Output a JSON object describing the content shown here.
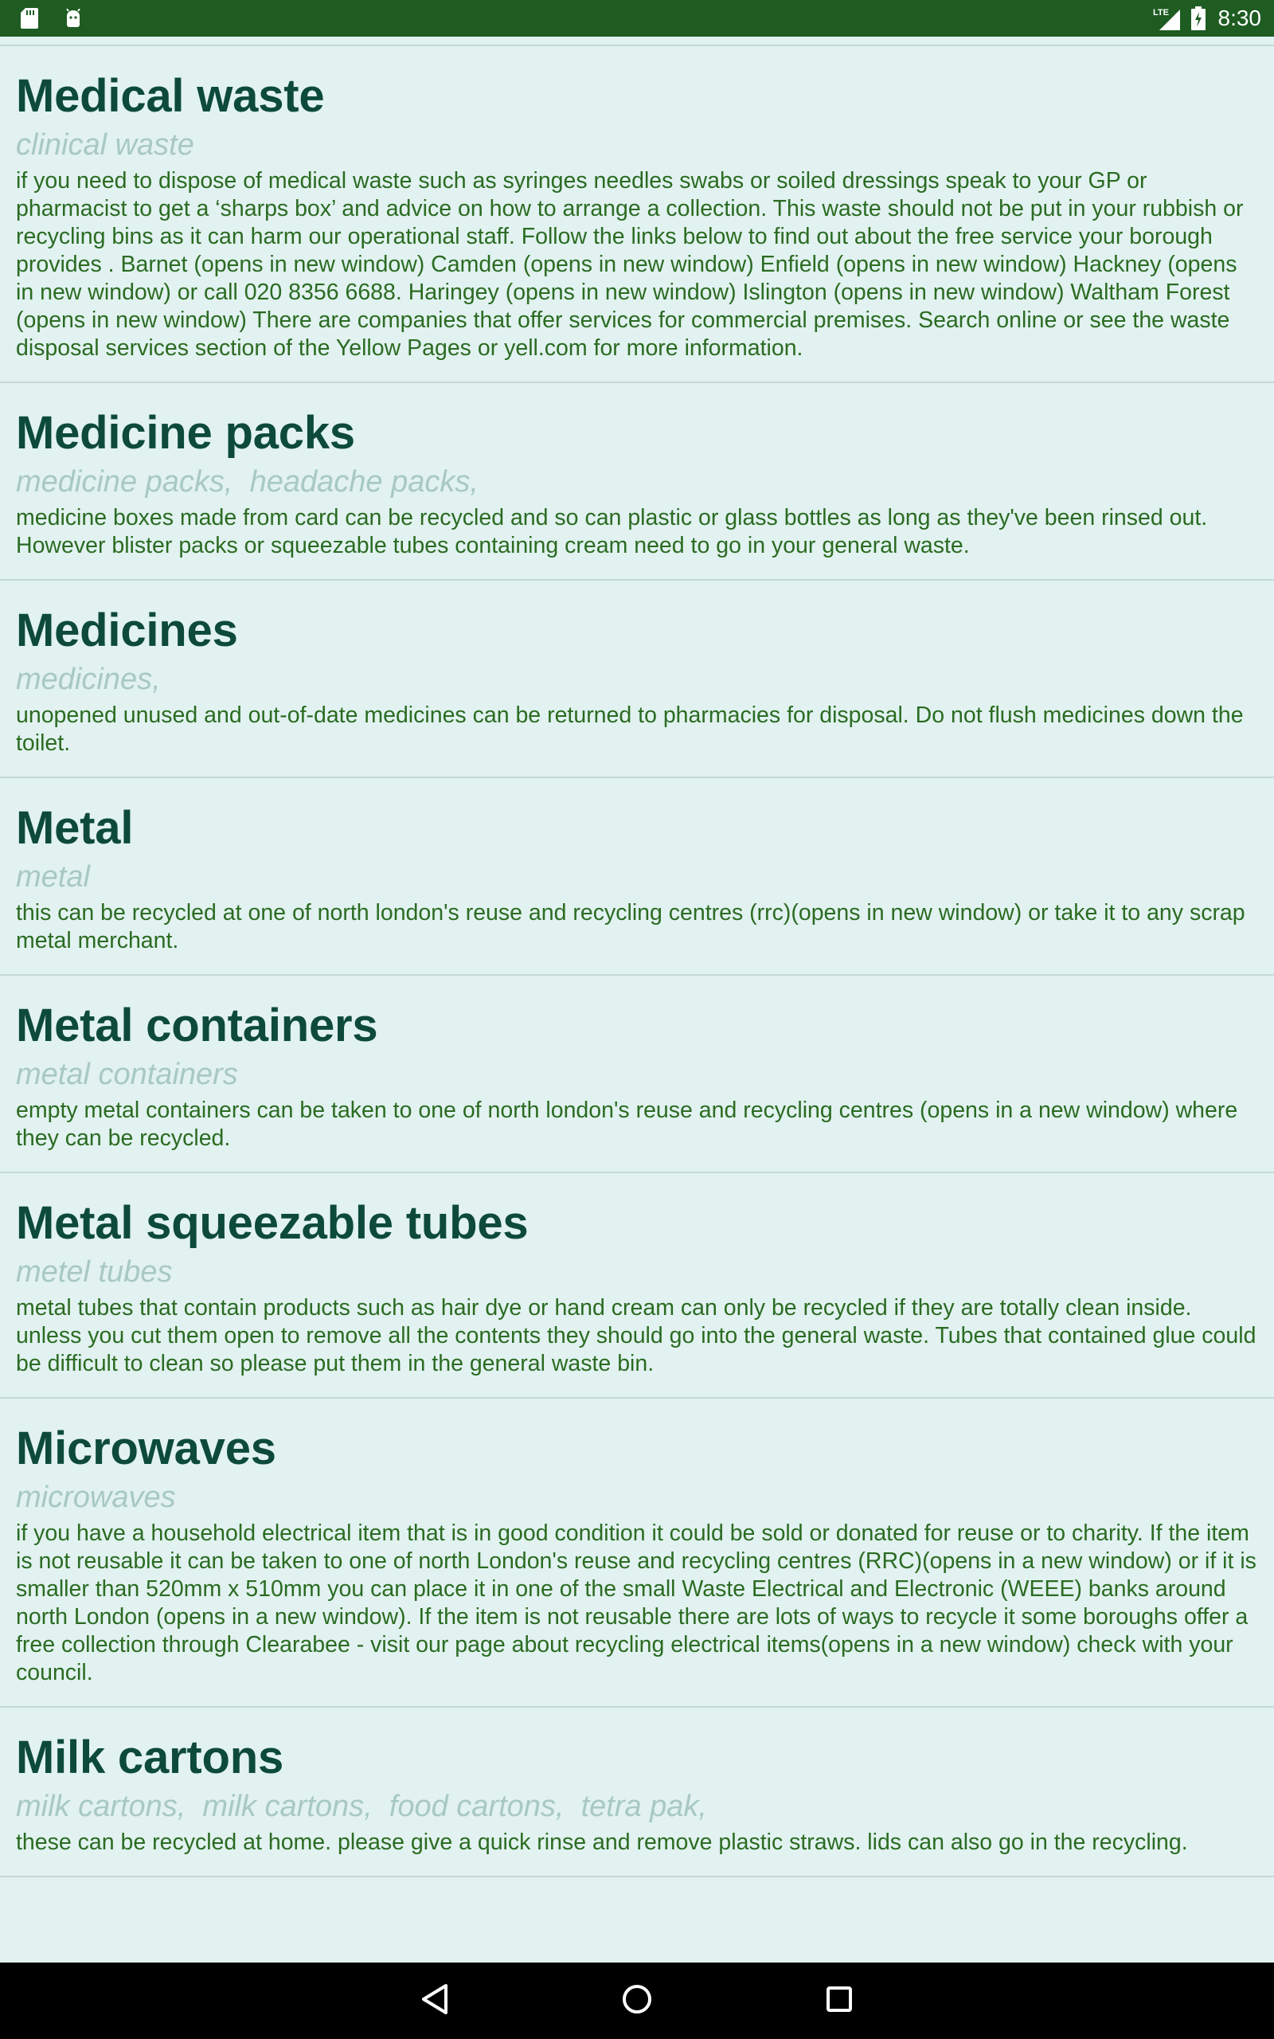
{
  "status_bar": {
    "time": "8:30",
    "network": "LTE",
    "icons": [
      "sd-card-icon",
      "android-icon",
      "signal-icon",
      "battery-icon"
    ]
  },
  "entries": [
    {
      "title": "Medical waste",
      "keywords": "clinical waste",
      "body": "if you need to dispose of medical waste such as syringes needles swabs or soiled dressings speak to your GP or pharmacist to get a ‘sharps box’ and advice on how to arrange a collection. This waste should not be put in your rubbish or recycling bins as it can harm our operational staff. Follow the links below to find out about the free service your borough provides . Barnet (opens in new window) Camden (opens in new window) Enfield (opens in new window) Hackney (opens in new window) or call 020 8356 6688. Haringey (opens in new window) Islington (opens in new window) Waltham Forest (opens in new window) There are companies that offer services for commercial premises. Search online or see the waste disposal services section of the Yellow Pages or yell.com for more information."
    },
    {
      "title": "Medicine packs",
      "keywords": "medicine packs,  headache packs,",
      "body": "medicine boxes made from card can be recycled and so can plastic or glass bottles as long as they've been rinsed out. However blister packs or squeezable tubes containing cream need to go in your general waste."
    },
    {
      "title": "Medicines",
      "keywords": "medicines,",
      "body": "unopened unused and out-of-date medicines can be returned to pharmacies for disposal. Do not flush medicines down the toilet."
    },
    {
      "title": "Metal",
      "keywords": "metal",
      "body": "this can be recycled at one of north london's reuse and recycling centres (rrc)(opens in new window) or take it to any scrap metal merchant."
    },
    {
      "title": "Metal containers",
      "keywords": "metal containers",
      "body": "empty metal containers can be taken to one of north london's reuse and recycling centres (opens in a new window) where they can be recycled."
    },
    {
      "title": "Metal squeezable tubes",
      "keywords": "metel tubes",
      "body": "metal tubes that contain products such as hair dye or hand cream can only be recycled if they are totally clean inside. unless you cut them open to remove all the contents they should go into the general waste. Tubes that contained glue could be difficult to clean so please put them in the general waste bin."
    },
    {
      "title": "Microwaves",
      "keywords": "microwaves",
      "body": "if you have a household electrical item that is in good condition it could be sold or donated for reuse or to charity. If the item is not reusable it can be taken to one of north London's reuse and recycling centres (RRC)(opens in a new window) or if it is smaller than 520mm x 510mm you can place it in one of the small Waste Electrical and Electronic (WEEE) banks around north London (opens in a new window). If the item is not reusable there are lots of ways to recycle it some boroughs offer a free collection through Clearabee - visit our page about recycling electrical items(opens in a new window) check with your council."
    },
    {
      "title": "Milk cartons",
      "keywords": "milk cartons,  milk cartons,  food cartons,  tetra pak,",
      "body": "these can be recycled at home. please give a quick rinse and remove plastic straws. lids can also go in the recycling."
    }
  ],
  "nav_bar": {
    "buttons": [
      "back-icon",
      "home-icon",
      "recents-icon"
    ]
  }
}
